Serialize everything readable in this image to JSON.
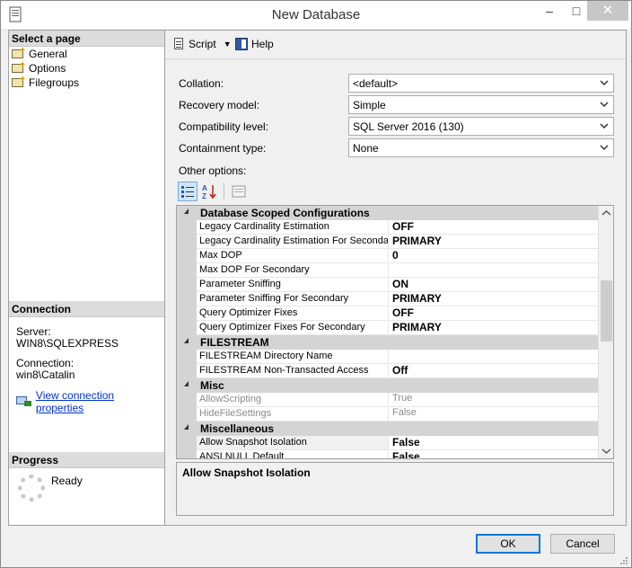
{
  "window": {
    "title": "New Database",
    "minimize_glyph": "–",
    "maximize_glyph": "□",
    "close_glyph": "✕"
  },
  "left": {
    "select_page_header": "Select a page",
    "pages": [
      {
        "label": "General",
        "icon": "page-wrench-icon"
      },
      {
        "label": "Options",
        "icon": "page-wrench-icon"
      },
      {
        "label": "Filegroups",
        "icon": "page-wrench-icon"
      }
    ],
    "connection": {
      "header": "Connection",
      "server_label": "Server:",
      "server_value": "WIN8\\SQLEXPRESS",
      "connection_label": "Connection:",
      "connection_value": "win8\\Catalin",
      "link_text": "View connection properties",
      "link_icon": "connection-properties-icon"
    },
    "progress": {
      "header": "Progress",
      "status": "Ready",
      "icon": "spinner-icon"
    }
  },
  "toolbar": {
    "script_label": "Script",
    "help_label": "Help"
  },
  "form": {
    "collation": {
      "label": "Collation:",
      "value": "<default>"
    },
    "recovery_model": {
      "label": "Recovery model:",
      "value": "Simple"
    },
    "compatibility_level": {
      "label": "Compatibility level:",
      "value": "SQL Server 2016 (130)"
    },
    "containment_type": {
      "label": "Containment type:",
      "value": "None"
    },
    "other_options_label": "Other options:"
  },
  "grid": {
    "rows": [
      {
        "type": "category",
        "label": "Database Scoped Configurations"
      },
      {
        "type": "prop",
        "name": "Legacy Cardinality Estimation",
        "value": "OFF"
      },
      {
        "type": "prop",
        "name": "Legacy Cardinality Estimation For Secondary",
        "value": "PRIMARY"
      },
      {
        "type": "prop",
        "name": "Max DOP",
        "value": "0"
      },
      {
        "type": "prop",
        "name": "Max DOP For Secondary",
        "value": ""
      },
      {
        "type": "prop",
        "name": "Parameter Sniffing",
        "value": "ON"
      },
      {
        "type": "prop",
        "name": "Parameter Sniffing For Secondary",
        "value": "PRIMARY"
      },
      {
        "type": "prop",
        "name": "Query Optimizer Fixes",
        "value": "OFF"
      },
      {
        "type": "prop",
        "name": "Query Optimizer Fixes For Secondary",
        "value": "PRIMARY"
      },
      {
        "type": "category",
        "label": "FILESTREAM"
      },
      {
        "type": "prop",
        "name": "FILESTREAM Directory Name",
        "value": ""
      },
      {
        "type": "prop",
        "name": "FILESTREAM Non-Transacted Access",
        "value": "Off"
      },
      {
        "type": "category",
        "label": "Misc"
      },
      {
        "type": "prop",
        "name": "AllowScripting",
        "value": "True",
        "dim": true
      },
      {
        "type": "prop",
        "name": "HideFileSettings",
        "value": "False",
        "dim": true
      },
      {
        "type": "category",
        "label": "Miscellaneous"
      },
      {
        "type": "prop",
        "name": "Allow Snapshot Isolation",
        "value": "False",
        "selected": true
      },
      {
        "type": "prop",
        "name": "ANSI NULL Default",
        "value": "False"
      }
    ],
    "description": "Allow Snapshot Isolation"
  },
  "buttons": {
    "ok": "OK",
    "cancel": "Cancel"
  }
}
